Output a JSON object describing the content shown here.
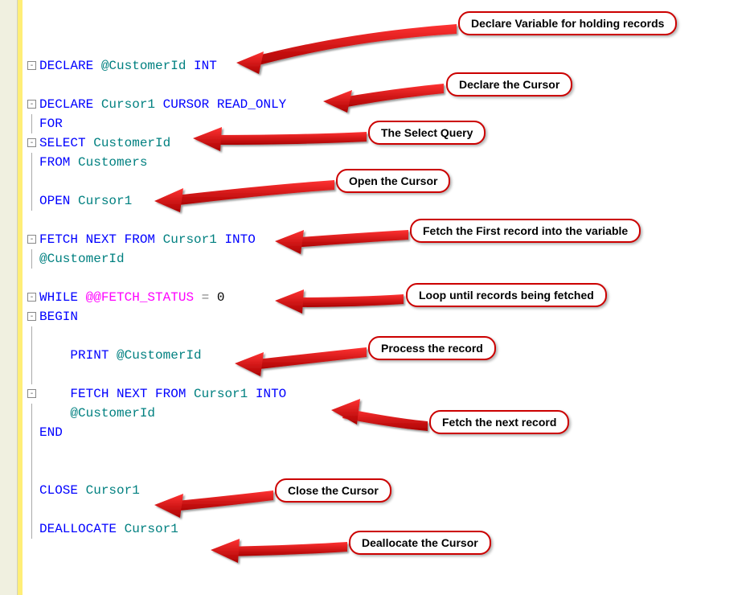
{
  "callouts": {
    "c1": "Declare Variable for holding records",
    "c2": "Declare the Cursor",
    "c3": "The Select Query",
    "c4": "Open the Cursor",
    "c5": "Fetch the First record into the variable",
    "c6": "Loop until records being fetched",
    "c7": "Process the record",
    "c8": "Fetch the next record",
    "c9": "Close the Cursor",
    "c10": "Deallocate the Cursor"
  },
  "code": {
    "l1_a": "DECLARE",
    "l1_b": " @CustomerId ",
    "l1_c": "INT",
    "l2_a": "DECLARE",
    "l2_b": " Cursor1 ",
    "l2_c": "CURSOR",
    "l2_d": " READ_ONLY",
    "l3_a": "FOR",
    "l4_a": "SELECT",
    "l4_b": " CustomerId",
    "l5_a": "FROM",
    "l5_b": " Customers",
    "l6_a": "OPEN",
    "l6_b": " Cursor1",
    "l7_a": "FETCH",
    "l7_b": " NEXT ",
    "l7_c": "FROM",
    "l7_d": " Cursor1 ",
    "l7_e": "INTO",
    "l8_a": "@CustomerId",
    "l9_a": "WHILE",
    "l9_b": " @@FETCH_STATUS",
    "l9_c": " = ",
    "l9_d": "0",
    "l10_a": "BEGIN",
    "l11_a": "PRINT",
    "l11_b": " @CustomerId",
    "l12_a": "FETCH",
    "l12_b": " NEXT ",
    "l12_c": "FROM",
    "l12_d": " Cursor1 ",
    "l12_e": "INTO",
    "l13_a": "@CustomerId",
    "l14_a": "END",
    "l15_a": "CLOSE",
    "l15_b": " Cursor1",
    "l16_a": "DEALLOCATE",
    "l16_b": " Cursor1"
  }
}
